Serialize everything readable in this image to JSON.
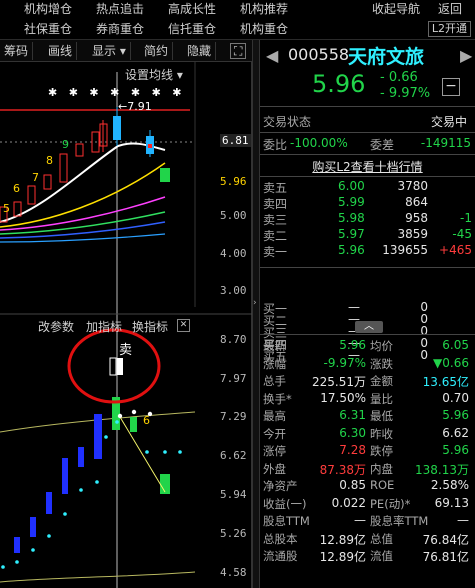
{
  "menu": {
    "row1": [
      "机构增仓",
      "热点追击",
      "高成长性",
      "机构推荐",
      "收起导航",
      "返回"
    ],
    "row2": [
      "社保重仓",
      "券商重仓",
      "信托重仓",
      "机构重仓"
    ],
    "l2_badge": "L2开通"
  },
  "toolbar": {
    "items": [
      "筹码",
      "画线",
      "显示 ▾",
      "简约",
      "隐藏"
    ],
    "close_icon": "✕"
  },
  "chart": {
    "settings_label": "设置均线 ▾",
    "stars": "✱ ✱ ✱ ✱ ✱ ✱ ✱",
    "high_annotation": "←7.91",
    "td_counts": [
      "5",
      "6",
      "7",
      "8",
      "9"
    ],
    "price_labels": [
      "6.81",
      "5.96",
      "5.00",
      "4.00",
      "3.00"
    ],
    "sub_toolbar": [
      "改参数",
      "加指标",
      "换指标"
    ],
    "sell_label": "卖",
    "sub_count": "6",
    "sub_labels": [
      "8.70",
      "7.97",
      "7.29",
      "6.62",
      "5.94",
      "5.26",
      "4.58"
    ]
  },
  "stock": {
    "code": "000558",
    "name": "天府文旅",
    "price": "5.96",
    "change": "- 0.66",
    "change_pct": "- 9.97%"
  },
  "status": {
    "label": "交易状态",
    "value": "交易中"
  },
  "weibi": {
    "label": "委比",
    "value": "-100.00%",
    "label2": "委差",
    "value2": "-149115"
  },
  "l2_promo": "购买L2查看十档行情",
  "asks": [
    {
      "label": "卖五",
      "price": "6.00",
      "vol": "3780",
      "chg": ""
    },
    {
      "label": "卖四",
      "price": "5.99",
      "vol": "864",
      "chg": ""
    },
    {
      "label": "卖三",
      "price": "5.98",
      "vol": "958",
      "chg": "-1"
    },
    {
      "label": "卖二",
      "price": "5.97",
      "vol": "3859",
      "chg": "-45"
    },
    {
      "label": "卖一",
      "price": "5.96",
      "vol": "139655",
      "chg": "+465"
    }
  ],
  "bids": [
    {
      "label": "买一",
      "price": "—",
      "vol": "0"
    },
    {
      "label": "买二",
      "price": "—",
      "vol": "0"
    },
    {
      "label": "买三",
      "price": "—",
      "vol": "0"
    },
    {
      "label": "买四",
      "price": "—",
      "vol": "0"
    },
    {
      "label": "买五",
      "price": "—",
      "vol": "0"
    }
  ],
  "stats": [
    {
      "l1": "最新",
      "v1": "5.96",
      "c1": "green",
      "l2": "均价",
      "v2": "6.05",
      "c2": "green"
    },
    {
      "l1": "涨幅",
      "v1": "-9.97%",
      "c1": "green",
      "l2": "涨跌",
      "v2": "▼0.66",
      "c2": "green"
    },
    {
      "l1": "总手",
      "v1": "225.51万",
      "c1": "white",
      "l2": "金额",
      "v2": "13.65亿",
      "c2": "cyan"
    },
    {
      "l1": "换手*",
      "v1": "17.50%",
      "c1": "white",
      "l2": "量比",
      "v2": "0.70",
      "c2": "white"
    },
    {
      "l1": "最高",
      "v1": "6.31",
      "c1": "green",
      "l2": "最低",
      "v2": "5.96",
      "c2": "green"
    },
    {
      "l1": "今开",
      "v1": "6.30",
      "c1": "green",
      "l2": "昨收",
      "v2": "6.62",
      "c2": "white"
    },
    {
      "l1": "涨停",
      "v1": "7.28",
      "c1": "red",
      "l2": "跌停",
      "v2": "5.96",
      "c2": "green"
    },
    {
      "l1": "外盘",
      "v1": "87.38万",
      "c1": "red",
      "l2": "内盘",
      "v2": "138.13万",
      "c2": "green"
    },
    {
      "l1": "净资产",
      "v1": "0.85",
      "c1": "white",
      "l2": "ROE",
      "v2": "2.58%",
      "c2": "white"
    },
    {
      "l1": "收益(一)",
      "v1": "0.022",
      "c1": "white",
      "l2": "PE(动)*",
      "v2": "69.13",
      "c2": "white"
    },
    {
      "l1": "股息TTM",
      "v1": "—",
      "c1": "white",
      "l2": "股息率TTM",
      "v2": "—",
      "c2": "white"
    },
    {
      "l1": "总股本",
      "v1": "12.89亿",
      "c1": "white",
      "l2": "总值",
      "v2": "76.84亿",
      "c2": "white"
    },
    {
      "l1": "流通股",
      "v1": "12.89亿",
      "c1": "white",
      "l2": "流值",
      "v2": "76.81亿",
      "c2": "white"
    }
  ],
  "colors": {
    "up": "#ff3c3c",
    "down": "#21d44a",
    "accent": "#2ff0ff",
    "bg": "#000000"
  }
}
